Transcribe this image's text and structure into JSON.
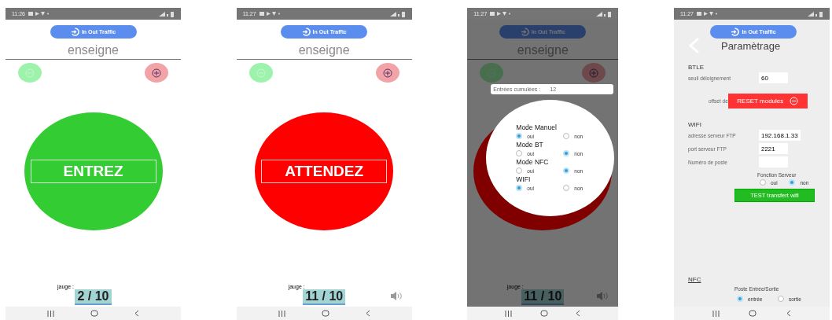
{
  "screens": [
    {
      "kind": "main",
      "time": "11:26",
      "app_button": "In Out Traffic",
      "title": "enseigne",
      "signal": {
        "label": "ENTREZ",
        "color": "#33cc33"
      },
      "gauge_label": "jauge :",
      "gauge_value": "2 / 10",
      "sound": false
    },
    {
      "kind": "main",
      "time": "11:27",
      "app_button": "In Out Traffic",
      "title": "enseigne",
      "signal": {
        "label": "ATTENDEZ",
        "color": "#ff0000"
      },
      "gauge_label": "jauge :",
      "gauge_value": "11 / 10",
      "sound": true
    },
    {
      "kind": "dialog",
      "time": "11:27",
      "app_button": "In Out Traffic",
      "title": "enseigne",
      "signal": {
        "color": "#800000"
      },
      "gauge_label": "jauge :",
      "gauge_value": "11 / 10",
      "sound": true,
      "dialog": {
        "counter_label": "Entrées cumulées :",
        "counter_value": "12",
        "modes": [
          {
            "label": "Mode Manuel",
            "options": [
              {
                "label": "oui",
                "selected": true
              },
              {
                "label": "non",
                "selected": false
              }
            ]
          },
          {
            "label": "Mode BT",
            "options": [
              {
                "label": "oui",
                "selected": false
              },
              {
                "label": "non",
                "selected": true
              }
            ]
          },
          {
            "label": "Mode NFC",
            "options": [
              {
                "label": "oui",
                "selected": false
              },
              {
                "label": "non",
                "selected": true
              }
            ]
          },
          {
            "label": "WIFI",
            "options": [
              {
                "label": "oui",
                "selected": true
              },
              {
                "label": "non",
                "selected": false
              }
            ]
          }
        ]
      }
    },
    {
      "kind": "settings",
      "time": "11:27",
      "app_button": "In Out Traffic",
      "title": "Paramètrage",
      "btle": {
        "heading": "BTLE",
        "threshold_label": "seuil déloignement",
        "threshold_value": "60",
        "offset_label": "offset de",
        "reset_button": "RESET modules"
      },
      "wifi": {
        "heading": "WIFI",
        "fields": [
          {
            "label": "adresse serveur FTP",
            "value": "192.168.1.33"
          },
          {
            "label": "port serveur FTP",
            "value": "2221"
          },
          {
            "label": "Numéro de poste"
          }
        ],
        "server_function": {
          "label": "Fonction Serveur",
          "options": [
            {
              "label": "oui",
              "selected": false
            },
            {
              "label": "non",
              "selected": true
            }
          ]
        },
        "test_button": "TEST transfert wifi"
      },
      "nfc": {
        "heading": "NFC",
        "station": {
          "label": "Poste Entrée/Sortie",
          "options": [
            {
              "label": "entrée",
              "selected": true
            },
            {
              "label": "sortie",
              "selected": false
            }
          ]
        }
      }
    }
  ]
}
